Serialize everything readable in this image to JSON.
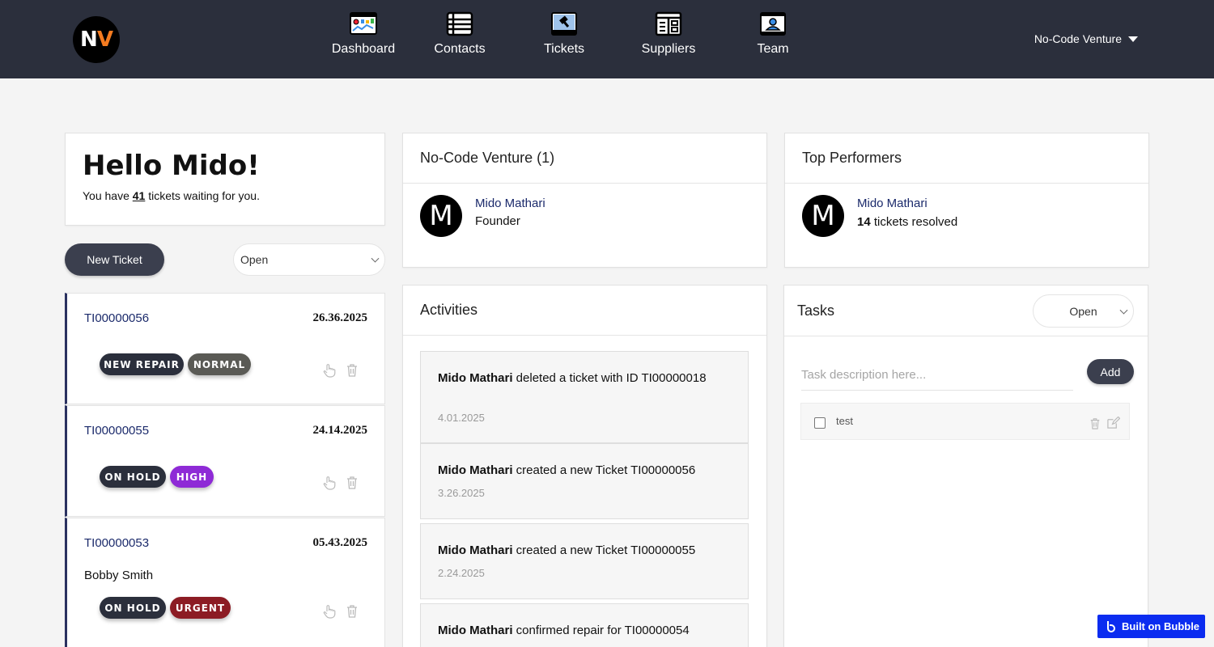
{
  "brand": {
    "logo_n": "N",
    "logo_v": "V",
    "accent": "#f47b20",
    "header_bg": "#2b2f3c"
  },
  "nav": {
    "items": [
      {
        "label": "Dashboard",
        "icon": "dashboard-icon"
      },
      {
        "label": "Contacts",
        "icon": "contacts-list-icon"
      },
      {
        "label": "Tickets",
        "icon": "hammer-ticket-icon"
      },
      {
        "label": "Suppliers",
        "icon": "suppliers-grid-icon"
      },
      {
        "label": "Team",
        "icon": "team-badge-icon"
      }
    ],
    "account_label": "No-Code Venture"
  },
  "greeting": {
    "title": "Hello Mido!",
    "prefix": "You have",
    "count": "41",
    "suffix": "tickets waiting for you."
  },
  "ticket_controls": {
    "new_ticket_label": "New Ticket",
    "status_filter": "Open"
  },
  "tickets": [
    {
      "id": "TI00000056",
      "date": "26.36.2025",
      "name": "",
      "badges": [
        {
          "label": "NEW REPAIR",
          "color": "#2b2f3c"
        },
        {
          "label": "NORMAL",
          "color": "#5a5a55"
        }
      ]
    },
    {
      "id": "TI00000055",
      "date": "24.14.2025",
      "name": "",
      "badges": [
        {
          "label": "ON HOLD",
          "color": "#2b2f3c"
        },
        {
          "label": "HIGH",
          "color": "#8e2ad6"
        }
      ]
    },
    {
      "id": "TI00000053",
      "date": "05.43.2025",
      "name": "Bobby Smith",
      "badges": [
        {
          "label": "ON HOLD",
          "color": "#2b2f3c"
        },
        {
          "label": "URGENT",
          "color": "#8c1c24"
        }
      ]
    }
  ],
  "team_card": {
    "title": "No-Code Venture (1)",
    "avatar": "M",
    "member_name": "Mido Mathari",
    "member_role": "Founder"
  },
  "top_performers": {
    "title": "Top Performers",
    "avatar": "M",
    "name": "Mido Mathari",
    "count": "14",
    "count_suffix": "tickets resolved"
  },
  "activities": {
    "title": "Activities",
    "items": [
      {
        "actor": "Mido Mathari",
        "text": "deleted a ticket with ID TI00000018",
        "date": "4.01.2025"
      },
      {
        "actor": "Mido Mathari",
        "text": "created a new Ticket TI00000056",
        "date": "3.26.2025"
      },
      {
        "actor": "Mido Mathari",
        "text": "created a new Ticket TI00000055",
        "date": "2.24.2025"
      },
      {
        "actor": "Mido Mathari",
        "text": "confirmed repair for TI00000054",
        "date": ""
      }
    ]
  },
  "tasks": {
    "title": "Tasks",
    "filter": "Open",
    "placeholder": "Task description here...",
    "add_label": "Add",
    "items": [
      {
        "label": "test",
        "checked": false
      }
    ]
  },
  "footer_badge": {
    "label": "Built on Bubble",
    "color": "#0b2cf0"
  }
}
